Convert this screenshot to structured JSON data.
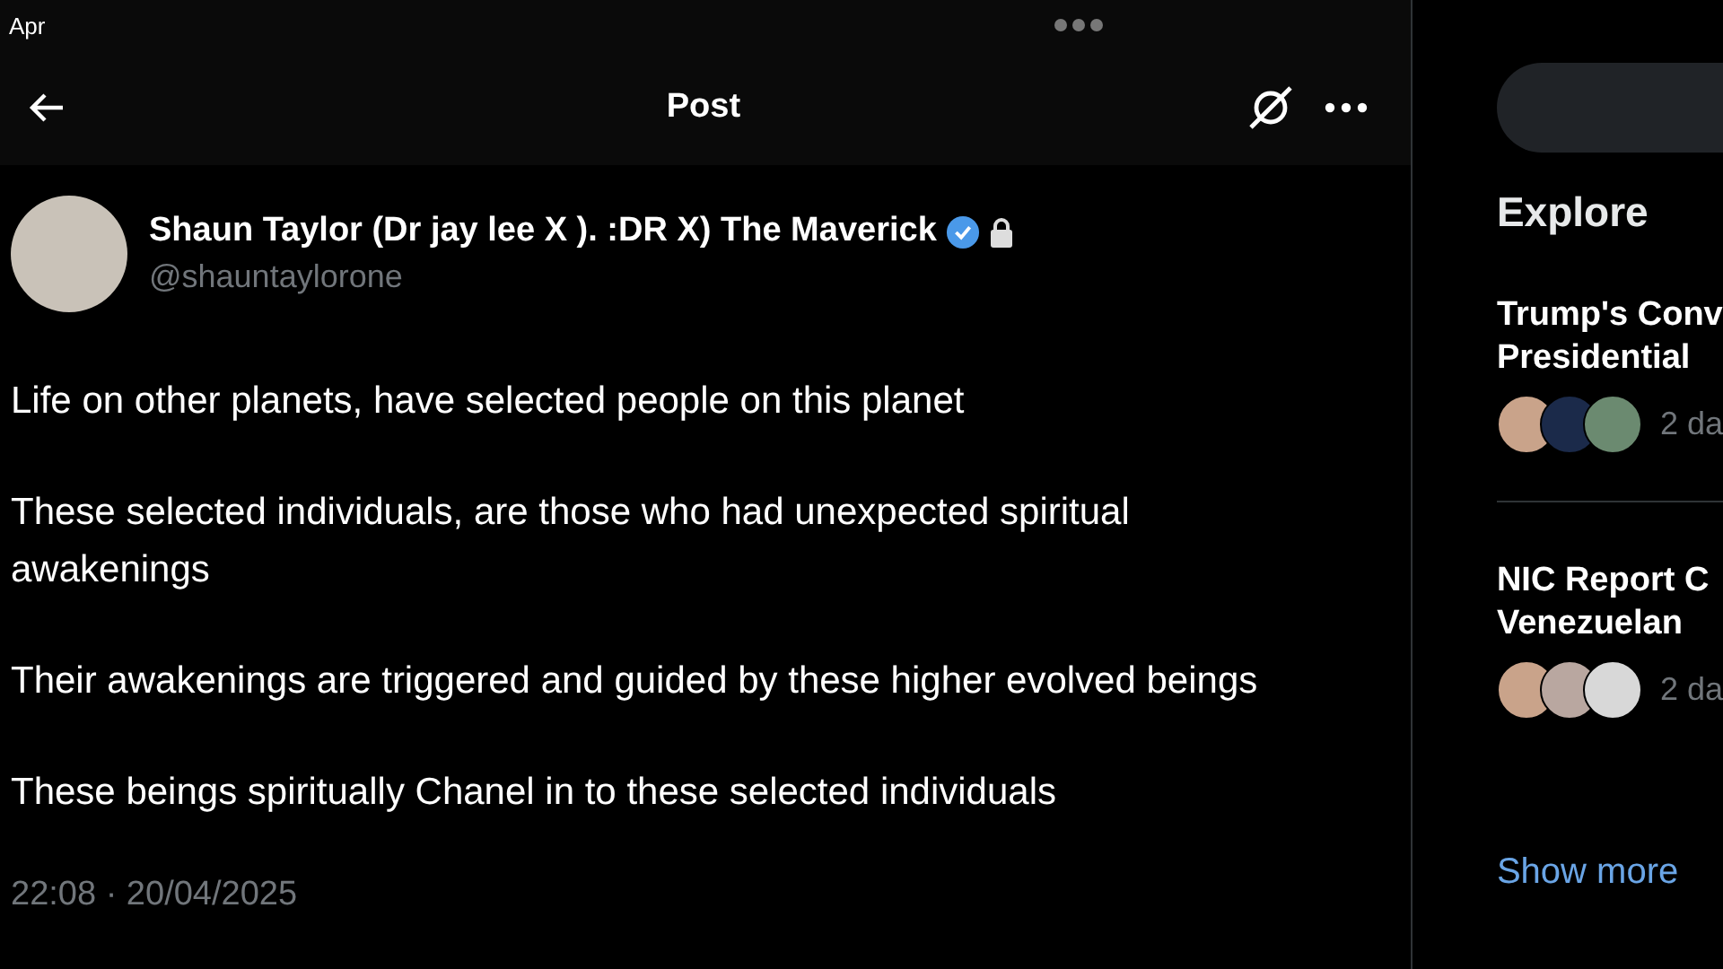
{
  "status_bar": {
    "text": "Apr"
  },
  "header": {
    "title": "Post"
  },
  "post": {
    "author": "Shaun Taylor (Dr jay lee X ). :DR X) The Maverick",
    "verified": true,
    "protected": true,
    "handle": "@shauntaylorone",
    "paragraphs": [
      "Life on other planets, have selected people on this planet",
      "These selected individuals, are those who had unexpected spiritual awakenings",
      "Their awakenings are triggered and guided by these higher evolved beings",
      "These beings spiritually Chanel in to these selected individuals"
    ],
    "timestamp": "22:08 · 20/04/2025"
  },
  "sidebar": {
    "title": "Explore",
    "trends": [
      {
        "title_lines": [
          "Trump's Conv",
          "Presidential"
        ],
        "meta": "2 da"
      },
      {
        "title_lines": [
          "NIC Report C",
          "Venezuelan"
        ],
        "meta": "2 da"
      }
    ],
    "show_more": "Show more"
  }
}
